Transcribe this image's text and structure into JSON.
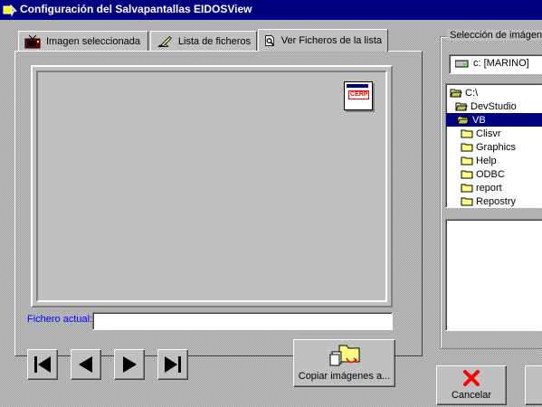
{
  "window": {
    "title": "Configuración del Salvapantallas EIDOSView",
    "title_icon": "app-icon"
  },
  "tabs": [
    {
      "label": "Imagen seleccionada",
      "icon": "tv-icon",
      "active": false
    },
    {
      "label": "Lista de ficheros",
      "icon": "pencil-list-icon",
      "active": false
    },
    {
      "label": "Ver Ficheros de la lista",
      "icon": "magnifier-document-icon",
      "active": true
    }
  ],
  "preview": {
    "thumbnail_label": "CERP"
  },
  "current_file": {
    "label": "Fichero actual:",
    "value": ""
  },
  "navigation": [
    {
      "name": "first-button",
      "icon": "first-icon"
    },
    {
      "name": "previous-button",
      "icon": "previous-icon"
    },
    {
      "name": "next-button",
      "icon": "next-icon"
    },
    {
      "name": "last-button",
      "icon": "last-icon"
    }
  ],
  "copy_button": {
    "label": "Copiar imágenes a...",
    "icon": "copy-folder-icon"
  },
  "selection": {
    "label": "Selección de imágene",
    "drive": "c: [MARINO]",
    "tree": [
      {
        "label": "C:\\",
        "level": 0,
        "selected": false,
        "open": true
      },
      {
        "label": "DevStudio",
        "level": 1,
        "selected": false,
        "open": true
      },
      {
        "label": "VB",
        "level": 2,
        "selected": true,
        "open": true
      },
      {
        "label": "Clisvr",
        "level": 3,
        "selected": false,
        "open": false
      },
      {
        "label": "Graphics",
        "level": 3,
        "selected": false,
        "open": false
      },
      {
        "label": "Help",
        "level": 3,
        "selected": false,
        "open": false
      },
      {
        "label": "ODBC",
        "level": 3,
        "selected": false,
        "open": false
      },
      {
        "label": "report",
        "level": 3,
        "selected": false,
        "open": false
      },
      {
        "label": "Repostry",
        "level": 3,
        "selected": false,
        "open": false
      }
    ]
  },
  "cancel_button": {
    "label": "Cancelar",
    "icon": "red-x-icon"
  },
  "colors": {
    "titlebar": "#000080",
    "selection": "#000080",
    "face": "#c0c0c0",
    "link": "#0000ff"
  }
}
